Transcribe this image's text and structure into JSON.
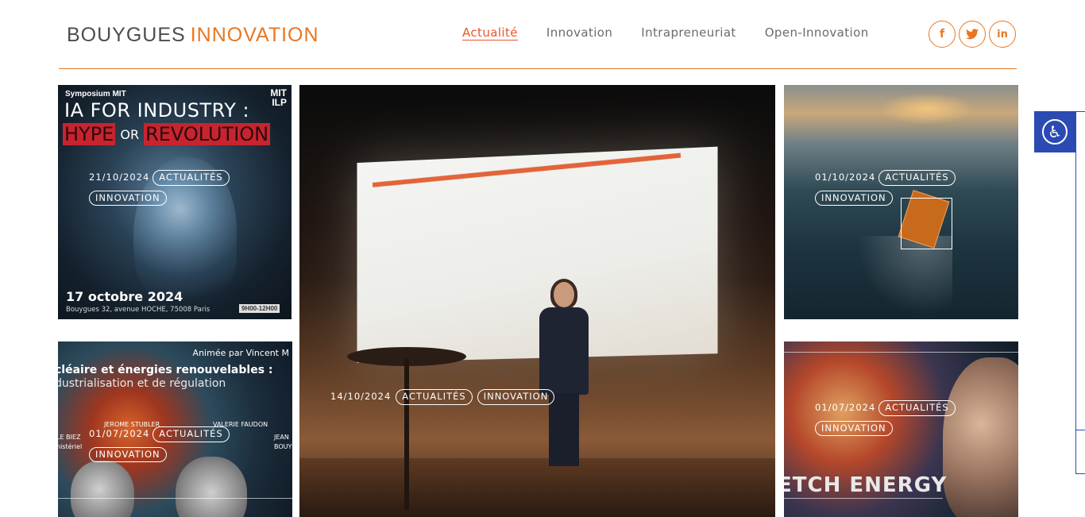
{
  "header": {
    "logo_part1": "BOUYGUES",
    "logo_part2": "INNOVATION",
    "nav": [
      {
        "label": "Actualité",
        "active": true
      },
      {
        "label": "Innovation",
        "active": false
      },
      {
        "label": "Intrapreneuriat",
        "active": false
      },
      {
        "label": "Open-Innovation",
        "active": false
      }
    ],
    "social": [
      {
        "icon": "facebook-icon",
        "glyph": "f"
      },
      {
        "icon": "twitter-icon",
        "glyph": "t"
      },
      {
        "icon": "linkedin-icon",
        "glyph": "in"
      }
    ]
  },
  "colors": {
    "accent": "#e87722",
    "active_nav": "#e8552a",
    "a11y": "#2b4bb3"
  },
  "cards": [
    {
      "date": "21/10/2024",
      "tags": [
        "ACTUALITÉS",
        "INNOVATION"
      ],
      "image_text": {
        "symposium": "Symposium MIT",
        "logo_top": "MIT",
        "logo_bottom": "ILP",
        "title_line1": "IA FOR INDUSTRY :",
        "hype": "HYPE",
        "or": "OR",
        "revolution": "REVOLUTION",
        "event_date": "17 octobre 2024",
        "address": "Bouygues 32, avenue HOCHE, 75008 Paris",
        "hours": "9H00-12H00"
      }
    },
    {
      "date": "14/10/2024",
      "tags": [
        "ACTUALITÉS",
        "INNOVATION"
      ]
    },
    {
      "date": "01/10/2024",
      "tags": [
        "ACTUALITÉS",
        "INNOVATION"
      ]
    },
    {
      "date": "01/07/2024",
      "tags": [
        "ACTUALITÉS",
        "INNOVATION"
      ],
      "image_text": {
        "animated_by": "Animée par Vincent M",
        "title_line1": "cléaire et énergies renouvelables :",
        "title_line2": "dustrialisation et de régulation",
        "name1": "JEROME STUBLER",
        "name2": "VALERIE FAUDON",
        "name3": "LE BIEZ",
        "name4": "JEAN",
        "role1": "nistériel",
        "role2": "BOUYG"
      }
    },
    {
      "date": "01/07/2024",
      "tags": [
        "ACTUALITÉS",
        "INNOVATION"
      ],
      "image_text": {
        "energy": "ETCH ENERGY"
      }
    }
  ],
  "accessibility": {
    "icon": "accessibility-icon",
    "glyph": "♿"
  }
}
